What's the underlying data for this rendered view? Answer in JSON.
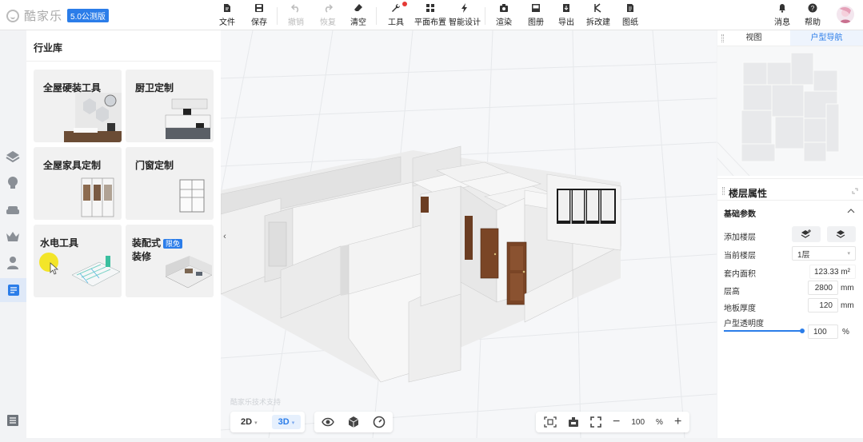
{
  "brand": {
    "name": "酷家乐",
    "version_badge": "5.0公测版"
  },
  "toolbar": {
    "file": "文件",
    "save": "保存",
    "undo": "撤销",
    "redo": "恢复",
    "clear": "清空",
    "tools": "工具",
    "floor_layout": "平面布置",
    "smart_design": "智能设计",
    "render": "渲染",
    "gallery": "图册",
    "export": "导出",
    "demolish": "拆改建",
    "drawings": "图纸",
    "messages": "消息",
    "help": "帮助"
  },
  "rail": {
    "icons": [
      "layers-icon",
      "lightbulb-icon",
      "sofa-icon",
      "crown-icon",
      "user-icon",
      "catalog-icon",
      "list-icon"
    ]
  },
  "library": {
    "title": "行业库",
    "cards": [
      {
        "title": "全屋硬装工具"
      },
      {
        "title": "厨卫定制"
      },
      {
        "title": "全屋家具定制"
      },
      {
        "title": "门窗定制"
      },
      {
        "title": "水电工具"
      },
      {
        "title": "装配式",
        "title2": "装修",
        "badge": "限免"
      }
    ]
  },
  "canvas": {
    "watermark": "酷家乐技术支持",
    "view_modes": [
      "2D",
      "3D"
    ],
    "active_view_mode": "3D",
    "zoom": {
      "value": "100",
      "unit": "%"
    }
  },
  "right_panel": {
    "tabs": [
      "视图",
      "户型导航"
    ],
    "active_tab": "户型导航",
    "props_title": "楼层属性",
    "section": "基础参数",
    "add_floor_label": "添加楼层",
    "current_floor_label": "当前楼层",
    "current_floor_value": "1层",
    "inner_area_label": "套内面积",
    "inner_area_value": "123.33",
    "inner_area_unit": "m²",
    "floor_height_label": "层高",
    "floor_height_value": "2800",
    "floor_height_unit": "mm",
    "slab_thickness_label": "地板厚度",
    "slab_thickness_value": "120",
    "slab_thickness_unit": "mm",
    "opacity_label": "户型透明度",
    "opacity_value": "100",
    "opacity_unit": "%",
    "opacity_fraction": 1.0
  },
  "colors": {
    "accent": "#2b7de9",
    "notification": "#e53935"
  }
}
